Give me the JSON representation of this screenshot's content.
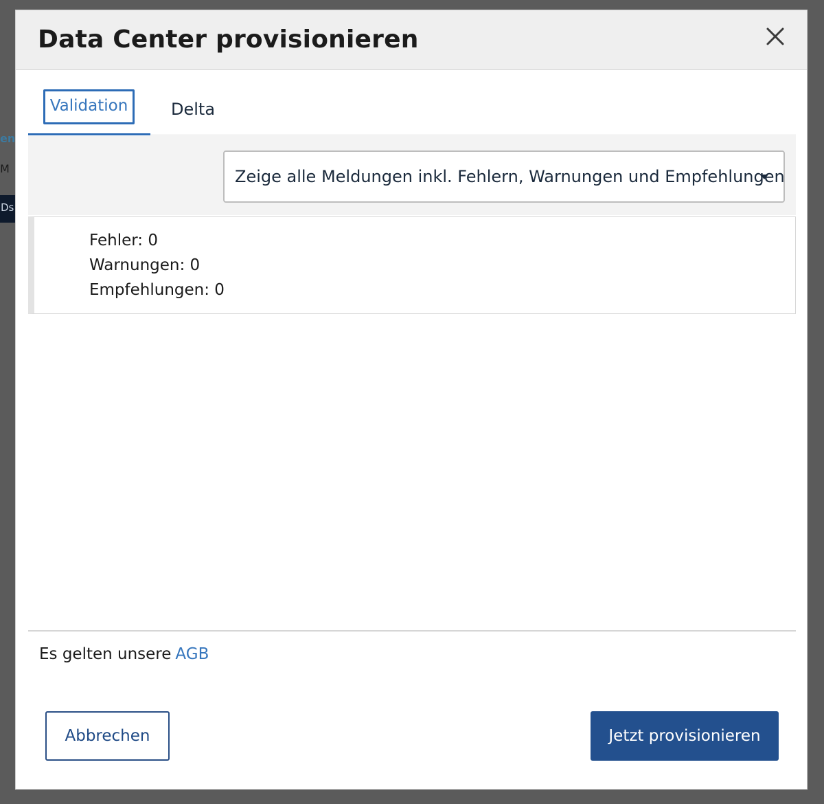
{
  "background": {
    "fragment_1": "en",
    "fragment_2": "M",
    "fragment_3": "Ds"
  },
  "dialog": {
    "title": "Data Center provisionieren",
    "close_icon": "close-icon"
  },
  "tabs": [
    {
      "label": "Validation",
      "active": true
    },
    {
      "label": "Delta",
      "active": false
    }
  ],
  "filter": {
    "selected": "Zeige alle Meldungen inkl. Fehlern, Warnungen und Empfehlungen",
    "caret_icon": "caret-down-icon"
  },
  "summary": {
    "errors": "Fehler: 0",
    "warnings": "Warnungen: 0",
    "recommendations": "Empfehlungen: 0"
  },
  "footer": {
    "terms_text": "Es gelten unsere",
    "terms_link": "AGB",
    "cancel_label": "Abbrechen",
    "submit_label": "Jetzt provisionieren"
  },
  "colors": {
    "accent": "#2d6cb6",
    "primary_button": "#23508e",
    "overlay": "#5b5b5b"
  }
}
